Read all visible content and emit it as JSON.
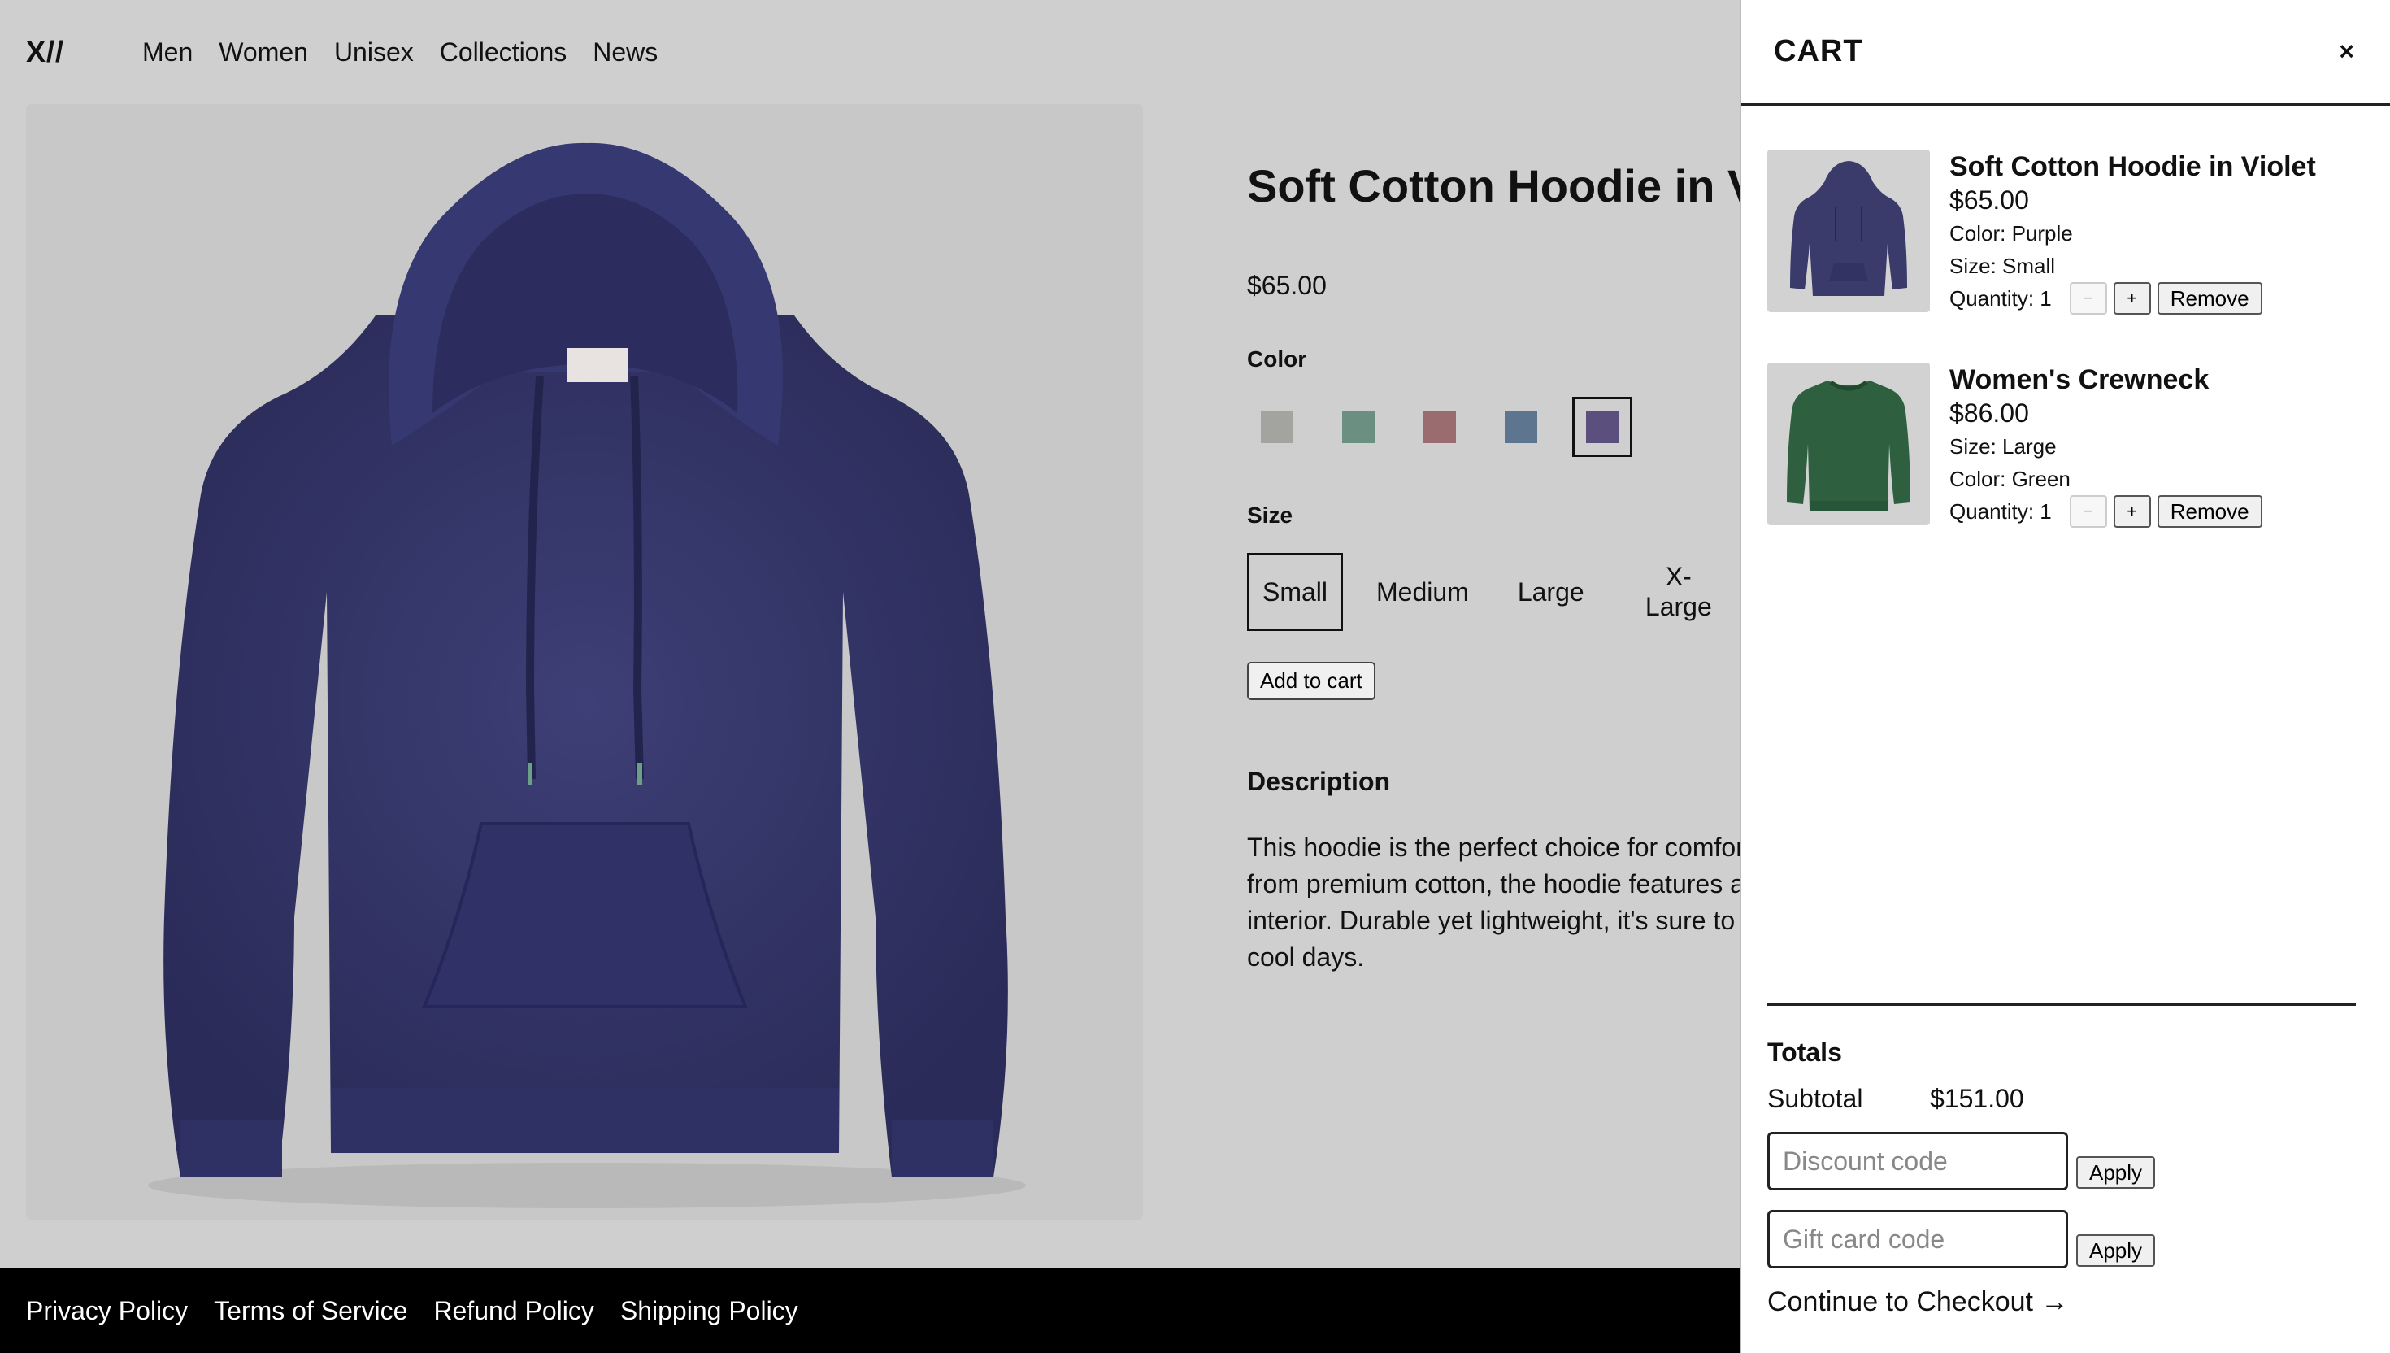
{
  "header": {
    "logo": "X//",
    "nav": [
      "Men",
      "Women",
      "Unisex",
      "Collections",
      "News"
    ]
  },
  "product": {
    "title": "Soft Cotton Hoodie in Violet",
    "price": "$65.00",
    "color_label": "Color",
    "colors": [
      {
        "name": "gray",
        "hex": "#a3a39f"
      },
      {
        "name": "sage",
        "hex": "#6b8f80"
      },
      {
        "name": "rose",
        "hex": "#9a6c70"
      },
      {
        "name": "slate-blue",
        "hex": "#5e7590"
      },
      {
        "name": "violet",
        "hex": "#5b4f7d"
      }
    ],
    "selected_color": 4,
    "size_label": "Size",
    "sizes": [
      "Small",
      "Medium",
      "Large",
      "X-Large"
    ],
    "selected_size": 0,
    "add_to_cart": "Add to cart",
    "description_title": "Description",
    "description": "This hoodie is the perfect choice for comfort and style. Made from premium cotton, the hoodie features a soft, plush fleece interior. Durable yet lightweight, it's sure to be your go-to for cool days."
  },
  "footer": {
    "links": [
      "Privacy Policy",
      "Terms of Service",
      "Refund Policy",
      "Shipping Policy"
    ]
  },
  "cart": {
    "title": "CART",
    "close": "×",
    "items": [
      {
        "name": "Soft Cotton Hoodie in Violet",
        "price": "$65.00",
        "attr1": "Color: Purple",
        "attr2": "Size: Small",
        "quantity": "Quantity: 1",
        "color": "#3a3b6a"
      },
      {
        "name": "Women's Crewneck",
        "price": "$86.00",
        "attr1": "Size: Large",
        "attr2": "Color: Green",
        "quantity": "Quantity: 1",
        "color": "#2e6040"
      }
    ],
    "minus": "−",
    "plus": "+",
    "remove": "Remove",
    "totals_title": "Totals",
    "subtotal_label": "Subtotal",
    "subtotal_value": "$151.00",
    "discount_placeholder": "Discount code",
    "gift_placeholder": "Gift card code",
    "apply": "Apply",
    "checkout": "Continue to Checkout →"
  },
  "colors": {
    "hoodie": "#343669",
    "backdrop": "#cfcfcf"
  }
}
